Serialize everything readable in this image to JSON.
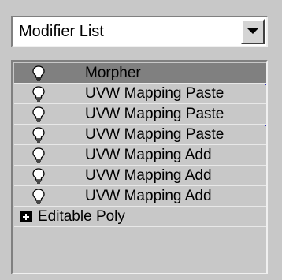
{
  "modifier_list": {
    "label": "Modifier List"
  },
  "stack": {
    "modifiers": [
      {
        "label": "Morpher",
        "selected": true
      },
      {
        "label": "UVW Mapping Paste",
        "selected": false
      },
      {
        "label": "UVW Mapping Paste",
        "selected": false
      },
      {
        "label": "UVW Mapping Paste",
        "selected": false
      },
      {
        "label": "UVW Mapping Add",
        "selected": false
      },
      {
        "label": "UVW Mapping Add",
        "selected": false
      },
      {
        "label": "UVW Mapping Add",
        "selected": false
      }
    ],
    "base_object": {
      "label": "Editable Poly"
    }
  },
  "icons": {
    "toggle": "lightbulb-icon",
    "expand": "plus-icon",
    "dropdown": "chevron-down-icon"
  },
  "colors": {
    "selected_row": "#808080",
    "panel_bg": "#c8c8c8"
  }
}
